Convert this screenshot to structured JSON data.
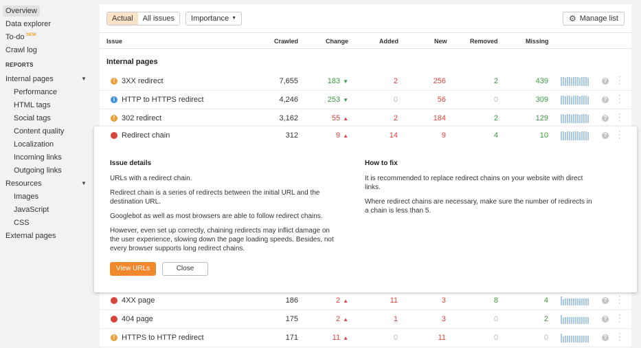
{
  "sidebar": {
    "items": [
      {
        "label": "Overview",
        "active": true
      },
      {
        "label": "Data explorer"
      },
      {
        "label": "To-do",
        "badge": "NEW"
      },
      {
        "label": "Crawl log"
      }
    ],
    "reports_header": "REPORTS",
    "reports": [
      {
        "label": "Internal pages",
        "caret": "▼"
      },
      {
        "label": "Performance",
        "sub": true
      },
      {
        "label": "HTML tags",
        "sub": true
      },
      {
        "label": "Social tags",
        "sub": true
      },
      {
        "label": "Content quality",
        "sub": true
      },
      {
        "label": "Localization",
        "sub": true
      },
      {
        "label": "Incoming links",
        "sub": true
      },
      {
        "label": "Outgoing links",
        "sub": true
      },
      {
        "label": "Resources",
        "caret": "▼"
      },
      {
        "label": "Images",
        "sub": true
      },
      {
        "label": "JavaScript",
        "sub": true
      },
      {
        "label": "CSS",
        "sub": true
      },
      {
        "label": "External pages"
      }
    ]
  },
  "toolbar": {
    "actual": "Actual",
    "all_issues": "All issues",
    "importance": "Importance",
    "manage_list": "Manage list"
  },
  "table": {
    "headers": {
      "issue": "Issue",
      "crawled": "Crawled",
      "change": "Change",
      "added": "Added",
      "new": "New",
      "removed": "Removed",
      "missing": "Missing"
    },
    "section_title": "Internal pages",
    "rows_top": [
      {
        "icon": "warning",
        "issue": "3XX redirect",
        "crawled": "7,655",
        "change": "183",
        "change_dir": "down",
        "added": "2",
        "new": "256",
        "removed": "2",
        "missing": "439"
      },
      {
        "icon": "info",
        "issue": "HTTP to HTTPS redirect",
        "crawled": "4,246",
        "change": "253",
        "change_dir": "down",
        "added": "0",
        "new": "56",
        "removed": "0",
        "missing": "309"
      },
      {
        "icon": "warning",
        "issue": "302 redirect",
        "crawled": "3,162",
        "change": "55",
        "change_dir": "up",
        "added": "2",
        "new": "184",
        "removed": "2",
        "missing": "129"
      }
    ],
    "expanded_row": {
      "icon": "error",
      "issue": "Redirect chain",
      "crawled": "312",
      "change": "9",
      "change_dir": "up",
      "added": "14",
      "new": "9",
      "removed": "4",
      "missing": "10"
    },
    "rows_bottom": [
      {
        "icon": "error",
        "issue": "4XX page",
        "crawled": "186",
        "change": "2",
        "change_dir": "up",
        "added": "11",
        "new": "3",
        "removed": "8",
        "missing": "4"
      },
      {
        "icon": "error",
        "issue": "404 page",
        "crawled": "175",
        "change": "2",
        "change_dir": "up",
        "added": "1",
        "new": "3",
        "removed": "0",
        "missing": "2"
      },
      {
        "icon": "warning",
        "issue": "HTTPS to HTTP redirect",
        "crawled": "171",
        "change": "11",
        "change_dir": "up",
        "added": "0",
        "new": "11",
        "removed": "0",
        "missing": "0"
      }
    ]
  },
  "details": {
    "issue_details_title": "Issue details",
    "issue_paragraphs": [
      "URLs with a redirect chain.",
      "Redirect chain is a series of redirects between the initial URL and the destination URL.",
      "Googlebot as well as most browsers are able to follow redirect chains.",
      "However, even set up correctly, chaining redirects may inflict damage on the user experience, slowing down the page loading speeds. Besides, not every browser supports long redirect chains."
    ],
    "how_to_fix_title": "How to fix",
    "fix_paragraphs": [
      "It is recommended to replace redirect chains on your website with direct links.",
      "Where redirect chains are necessary, make sure the number of redirects in a chain is less than 5."
    ],
    "view_urls": "View URLs",
    "close": "Close"
  },
  "colors": {
    "accent": "#f0882c",
    "red": "#d8433b",
    "green": "#3a9a3e",
    "spark": "#a8c8e8"
  }
}
